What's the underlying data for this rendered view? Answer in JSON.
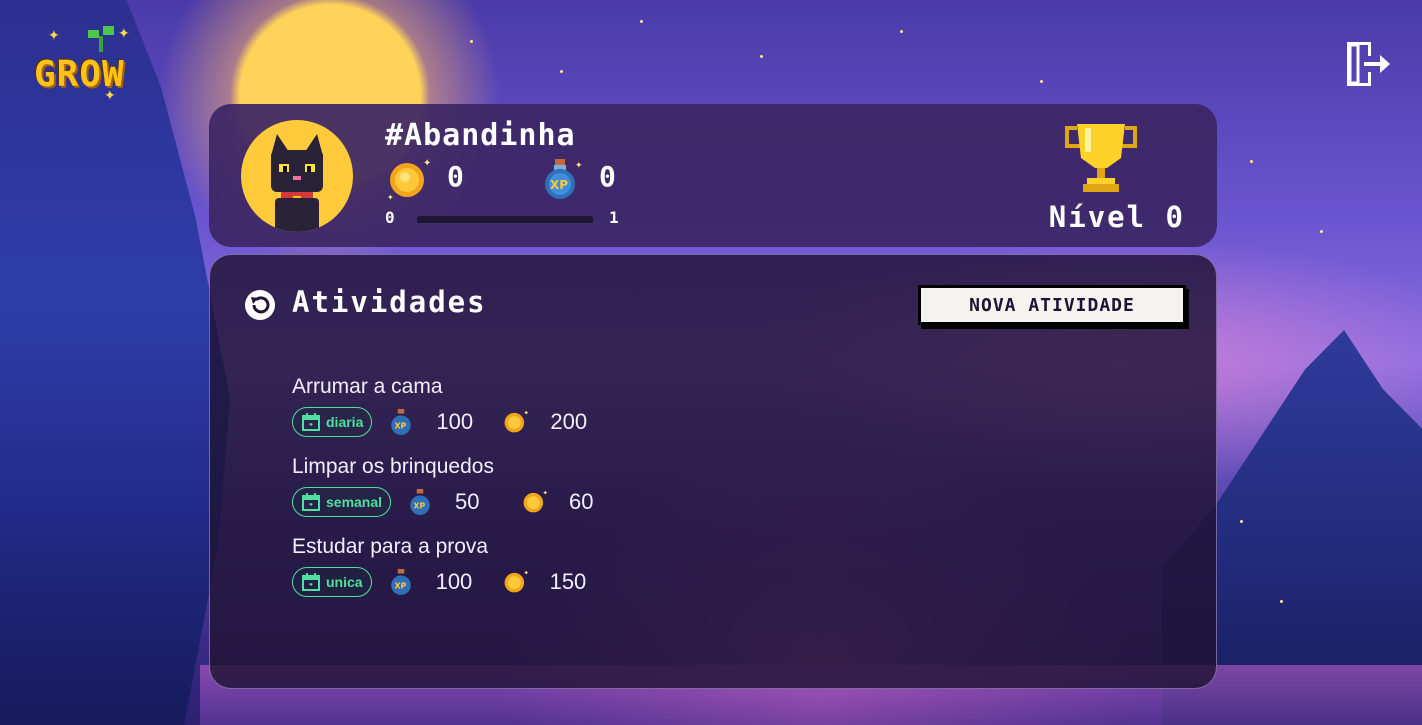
{
  "app": {
    "logo_text": "GROW"
  },
  "profile": {
    "username": "#Abandinha",
    "coins": "0",
    "xp": "0",
    "progress_min": "0",
    "progress_max": "1",
    "progress_fraction": 0,
    "level_label": "Nível 0"
  },
  "activities_panel": {
    "title": "Atividades",
    "new_button_label": "NOVA ATIVIDADE",
    "items": [
      {
        "name": "Arrumar a cama",
        "frequency": "diaria",
        "xp": "100",
        "coins": "200"
      },
      {
        "name": "Limpar os brinquedos",
        "frequency": "semanal",
        "xp": "50",
        "coins": "60"
      },
      {
        "name": "Estudar para a prova",
        "frequency": "unica",
        "xp": "100",
        "coins": "150"
      }
    ]
  },
  "colors": {
    "accent_gold": "#ffcb3a",
    "frequency_badge": "#4fe0a0",
    "card_bg": "#3c2664",
    "panel_bg": "#201434"
  },
  "icons": [
    "grow-logo",
    "logout-icon",
    "cat-avatar",
    "coin-icon",
    "xp-potion-icon",
    "trophy-icon",
    "back-arrow-icon",
    "calendar-icon"
  ]
}
